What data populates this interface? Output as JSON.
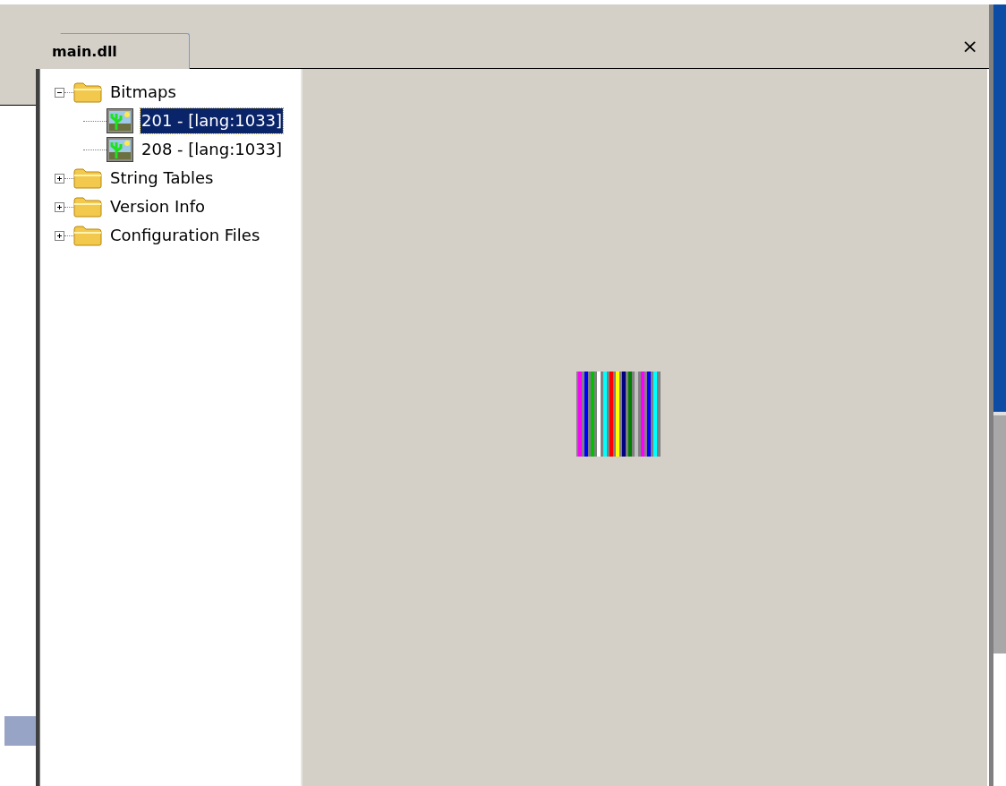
{
  "tabs": [
    {
      "label": "main.dll",
      "selected": true
    }
  ],
  "close_button": "×",
  "tree": [
    {
      "label": "Bitmaps",
      "kind": "folder",
      "expanded": true,
      "selected": false,
      "children": [
        {
          "label": "201 - [lang:1033]",
          "kind": "bitmap",
          "selected": true
        },
        {
          "label": "208 - [lang:1033]",
          "kind": "bitmap",
          "selected": false
        }
      ]
    },
    {
      "label": "String Tables",
      "kind": "folder",
      "expanded": false,
      "selected": false
    },
    {
      "label": "Version Info",
      "kind": "folder",
      "expanded": false,
      "selected": false
    },
    {
      "label": "Configuration Files",
      "kind": "folder",
      "expanded": false,
      "selected": false
    }
  ]
}
